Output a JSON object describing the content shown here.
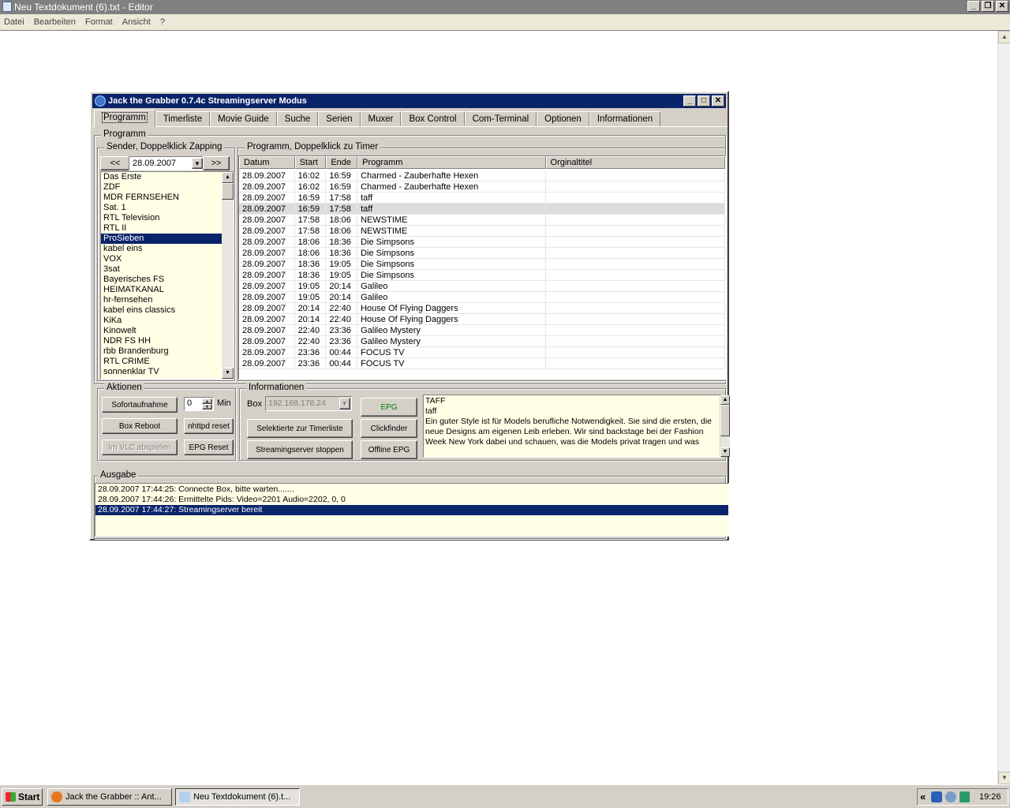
{
  "notepad": {
    "title": "Neu Textdokument (6).txt - Editor",
    "menu": [
      "Datei",
      "Bearbeiten",
      "Format",
      "Ansicht",
      "?"
    ]
  },
  "grabber": {
    "title": "Jack the Grabber 0.7.4c Streamingserver Modus",
    "tabs": [
      "Programm",
      "Timerliste",
      "Movie Guide",
      "Suche",
      "Serien",
      "Muxer",
      "Box Control",
      "Com-Terminal",
      "Optionen",
      "Informationen"
    ],
    "active_tab": "Programm",
    "programm_group": "Programm",
    "sender_group": "Sender, Doppelklick Zapping",
    "prev_label": "<<",
    "next_label": ">>",
    "date": "28.09.2007",
    "channels": [
      "Das Erste",
      "ZDF",
      "MDR FERNSEHEN",
      "Sat. 1",
      "RTL Television",
      "RTL II",
      "ProSieben",
      "kabel eins",
      "VOX",
      "3sat",
      "Bayerisches FS",
      "HEIMATKANAL",
      "hr-fernsehen",
      "kabel eins classics",
      "KiKa",
      "Kinowelt",
      "NDR FS HH",
      "rbb Brandenburg",
      "RTL CRIME",
      "sonnenklar TV"
    ],
    "selected_channel": "ProSieben",
    "program_group": "Programm, Doppelklick zu Timer",
    "program_headers": [
      "Datum",
      "Start",
      "Ende",
      "Programm",
      "Orginaltitel"
    ],
    "programs": [
      [
        "28.09.2007",
        "16:02",
        "16:59",
        "Charmed - Zauberhafte Hexen",
        ""
      ],
      [
        "28.09.2007",
        "16:02",
        "16:59",
        "Charmed - Zauberhafte Hexen",
        ""
      ],
      [
        "28.09.2007",
        "16:59",
        "17:58",
        "taff",
        ""
      ],
      [
        "28.09.2007",
        "16:59",
        "17:58",
        "taff",
        ""
      ],
      [
        "28.09.2007",
        "17:58",
        "18:06",
        "NEWSTIME",
        ""
      ],
      [
        "28.09.2007",
        "17:58",
        "18:06",
        "NEWSTIME",
        ""
      ],
      [
        "28.09.2007",
        "18:06",
        "18:36",
        "Die Simpsons",
        ""
      ],
      [
        "28.09.2007",
        "18:06",
        "18:36",
        "Die Simpsons",
        ""
      ],
      [
        "28.09.2007",
        "18:36",
        "19:05",
        "Die Simpsons",
        ""
      ],
      [
        "28.09.2007",
        "18:36",
        "19:05",
        "Die Simpsons",
        ""
      ],
      [
        "28.09.2007",
        "19:05",
        "20:14",
        "Galileo",
        ""
      ],
      [
        "28.09.2007",
        "19:05",
        "20:14",
        "Galileo",
        ""
      ],
      [
        "28.09.2007",
        "20:14",
        "22:40",
        "House Of Flying Daggers",
        ""
      ],
      [
        "28.09.2007",
        "20:14",
        "22:40",
        "House Of Flying Daggers",
        ""
      ],
      [
        "28.09.2007",
        "22:40",
        "23:36",
        "Galileo Mystery",
        ""
      ],
      [
        "28.09.2007",
        "22:40",
        "23:36",
        "Galileo Mystery",
        ""
      ],
      [
        "28.09.2007",
        "23:36",
        "00:44",
        "FOCUS TV",
        ""
      ],
      [
        "28.09.2007",
        "23:36",
        "00:44",
        "FOCUS TV",
        ""
      ]
    ],
    "highlighted_row": 3,
    "aktionen_group": "Aktionen",
    "sofortaufnahme": "Sofortaufnahme",
    "min_value": "0",
    "min_label": "Min",
    "box_reboot": "Box Reboot",
    "nhttpd_reset": "nhttpd reset",
    "vlc": "Im VLC abspielen",
    "epg_reset": "EPG Reset",
    "info_group": "Informationen",
    "box_label": "Box",
    "box_ip": "192.168.178.24",
    "epg_btn": "EPG",
    "timer_btn": "Selektierte zur Timerliste",
    "clickfinder_btn": "Clickfinder",
    "stop_btn": "Streamingserver stoppen",
    "offline_epg_btn": "Offline EPG",
    "desc_title": "TAFF",
    "desc_sub": "taff",
    "desc_text": "Ein guter Style ist für Models berufliche Notwendigkeit. Sie sind die ersten, die neue Designs am eigenen Leib erleben. Wir sind backstage bei der Fashion Week New York dabei und schauen, was die Models privat tragen und was",
    "ausgabe_group": "Ausgabe",
    "log": [
      "28.09.2007 17:44:25: Connecte Box, bitte warten.......",
      "28.09.2007 17:44:26: Ermittelte Pids: Video=2201 Audio=2202, 0, 0",
      "28.09.2007 17:44:27: Streamingserver bereit"
    ],
    "log_selected": 2
  },
  "taskbar": {
    "start": "Start",
    "items": [
      "Jack the Grabber :: Ant...",
      "Neu Textdokument (6).t..."
    ],
    "tray_chevron": "«",
    "clock": "19:26"
  },
  "colors": {
    "selection": "#0a246a",
    "list_bg": "#ffffe6",
    "face": "#d4d0c8",
    "epg_text": "#008000"
  }
}
